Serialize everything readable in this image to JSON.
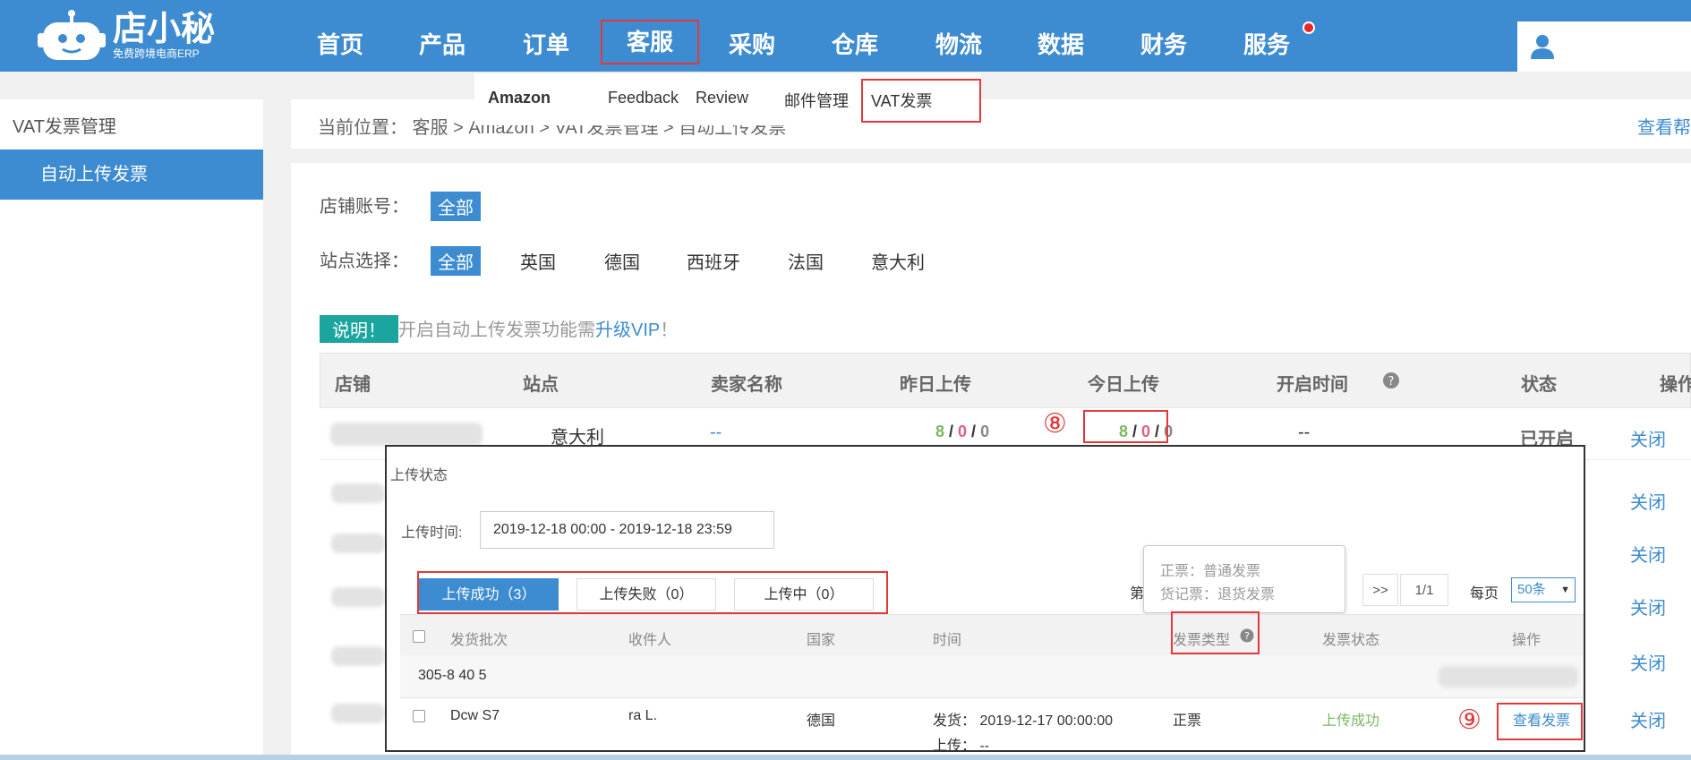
{
  "logo": {
    "name": "店小秘",
    "slogan": "免费跨境电商ERP"
  },
  "nav": {
    "items": [
      "首页",
      "产品",
      "订单",
      "客服",
      "采购",
      "仓库",
      "物流",
      "数据",
      "财务",
      "服务"
    ],
    "active": "客服"
  },
  "submenu": {
    "items": [
      "Amazon",
      "Feedback",
      "Review",
      "邮件管理",
      "VAT发票"
    ],
    "active": "VAT发票"
  },
  "sidebar": {
    "title": "VAT发票管理",
    "item": "自动上传发票"
  },
  "breadcrumb": {
    "text": "当前位置：  客服 > Amazon > VAT发票管理 > 自动上传发票",
    "help": "查看帮"
  },
  "filters": {
    "store_label": "店铺账号：",
    "store_selected": "全部",
    "site_label": "站点选择：",
    "sites": [
      "全部",
      "英国",
      "德国",
      "西班牙",
      "法国",
      "意大利"
    ],
    "site_selected": "全部"
  },
  "notice": {
    "tag": "说明！",
    "text": "开启自动上传发票功能需",
    "link": "升级VIP",
    "tail": "！"
  },
  "main_table": {
    "headers": [
      "店铺",
      "站点",
      "卖家名称",
      "昨日上传",
      "今日上传",
      "开启时间",
      "状态",
      "操作"
    ],
    "first_row": {
      "site": "意大利",
      "seller": "--",
      "yesterday": [
        "8",
        "0",
        "0"
      ],
      "today": [
        "8",
        "0",
        "0"
      ],
      "open_time": "--",
      "status": "已开启",
      "action": "关闭"
    },
    "close_label": "关闭"
  },
  "popup": {
    "title": "上传状态",
    "time_label": "上传时间:",
    "time_value": "2019-12-18 00:00 - 2019-12-18 23:59",
    "tabs": [
      "上传成功（3）",
      "上传失败（0）",
      "上传中（0）"
    ],
    "pager": {
      "prefix": "第",
      "next": ">>",
      "page": "1/1",
      "per_page_label": "每页",
      "per_page": "50条"
    },
    "tooltip": [
      "正票：普通发票",
      "货记票：退货发票"
    ],
    "headers": [
      "发货批次",
      "收件人",
      "国家",
      "时间",
      "发票类型",
      "发票状态",
      "操作"
    ],
    "batch": "305-8        40     5",
    "row": {
      "batch": "Dcw        S7",
      "recipient": "        ra L.",
      "country": "德国",
      "ship_time": "发货：  2019-12-17 00:00:00",
      "upload_time": "上传：  --",
      "type": "正票",
      "status": "上传成功",
      "action": "查看发票"
    }
  },
  "annotations": [
    "⑧",
    "⑨"
  ],
  "colors": {
    "brand": "#3d8bd0",
    "highlight": "#e23a3a",
    "teal": "#1aa59e",
    "success": "#7ab860"
  }
}
